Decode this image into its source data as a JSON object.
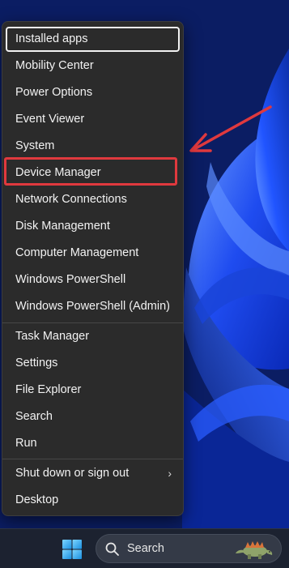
{
  "menu": {
    "items": [
      {
        "label": "Installed apps",
        "name": "menu-item-installed-apps"
      },
      {
        "label": "Mobility Center",
        "name": "menu-item-mobility-center"
      },
      {
        "label": "Power Options",
        "name": "menu-item-power-options"
      },
      {
        "label": "Event Viewer",
        "name": "menu-item-event-viewer"
      },
      {
        "label": "System",
        "name": "menu-item-system"
      },
      {
        "label": "Device Manager",
        "name": "menu-item-device-manager"
      },
      {
        "label": "Network Connections",
        "name": "menu-item-network-connections"
      },
      {
        "label": "Disk Management",
        "name": "menu-item-disk-management"
      },
      {
        "label": "Computer Management",
        "name": "menu-item-computer-management"
      },
      {
        "label": "Windows PowerShell",
        "name": "menu-item-windows-powershell"
      },
      {
        "label": "Windows PowerShell (Admin)",
        "name": "menu-item-windows-powershell-admin"
      },
      {
        "label": "Task Manager",
        "name": "menu-item-task-manager"
      },
      {
        "label": "Settings",
        "name": "menu-item-settings"
      },
      {
        "label": "File Explorer",
        "name": "menu-item-file-explorer"
      },
      {
        "label": "Search",
        "name": "menu-item-search"
      },
      {
        "label": "Run",
        "name": "menu-item-run"
      },
      {
        "label": "Shut down or sign out",
        "name": "menu-item-shut-down-or-sign-out"
      },
      {
        "label": "Desktop",
        "name": "menu-item-desktop"
      }
    ],
    "submenu_indicator": "›"
  },
  "annotation": {
    "highlight_color": "#e0393e",
    "arrow_color": "#e0393e"
  },
  "taskbar": {
    "search_label": "Search",
    "start_icon": "windows-logo-icon",
    "search_icon": "search-icon",
    "widget_icon": "dinosaur-doodle-icon"
  },
  "colors": {
    "menu_background": "#2b2b2b",
    "menu_text": "#f2f2f2",
    "taskbar_background": "#1c2230",
    "start_blue": "#4cc2ff"
  }
}
